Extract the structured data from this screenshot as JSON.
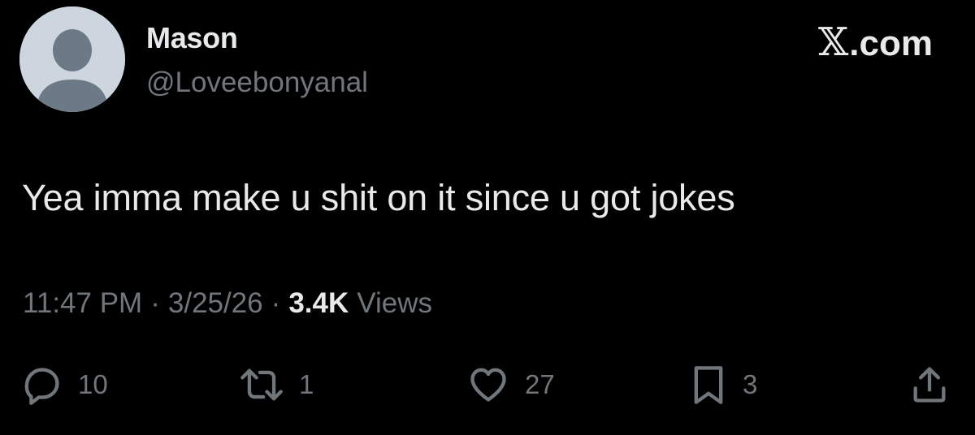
{
  "author": {
    "display_name": "Mason",
    "handle": "@Loveebonyanal",
    "avatar_icon": "default-avatar-icon"
  },
  "brand": {
    "x_glyph": "𝕏",
    "suffix": ".com"
  },
  "tweet": {
    "text": "Yea imma make u shit on it since u got jokes"
  },
  "meta": {
    "time": "11:47 PM",
    "separator": "·",
    "date": "3/25/26",
    "views_count": "3.4K",
    "views_label": "Views"
  },
  "actions": {
    "replies": {
      "icon": "reply-icon",
      "count": "10"
    },
    "retweets": {
      "icon": "retweet-icon",
      "count": "1"
    },
    "likes": {
      "icon": "heart-icon",
      "count": "27"
    },
    "bookmarks": {
      "icon": "bookmark-icon",
      "count": "3"
    },
    "share": {
      "icon": "share-icon"
    }
  },
  "colors": {
    "background": "#000000",
    "primary_text": "#e7e9ea",
    "secondary_text": "#71767b",
    "avatar_bg": "#cdd5de",
    "avatar_fg": "#6b7a86"
  }
}
